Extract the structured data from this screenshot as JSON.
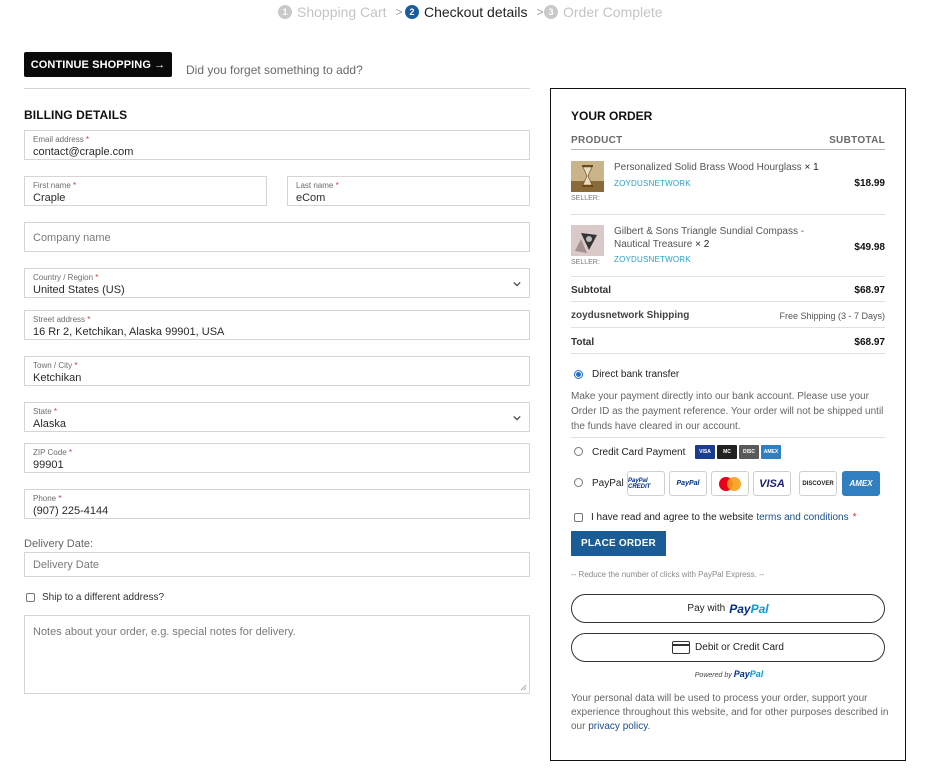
{
  "steps": [
    {
      "num": "1",
      "label": "Shopping Cart"
    },
    {
      "num": "2",
      "label": "Checkout details"
    },
    {
      "num": "3",
      "label": "Order Complete"
    }
  ],
  "continue_label": "CONTINUE SHOPPING →",
  "forgot_text": "Did you forget something to add?",
  "billing": {
    "title": "BILLING DETAILS",
    "email": {
      "label": "Email address",
      "value": "contact@craple.com"
    },
    "first_name": {
      "label": "First name",
      "value": "Craple"
    },
    "last_name": {
      "label": "Last name",
      "value": "eCom"
    },
    "company": {
      "placeholder": "Company name"
    },
    "country": {
      "label": "Country / Region",
      "value": "United States (US)"
    },
    "street": {
      "label": "Street address",
      "value": "16 Rr 2, Ketchikan, Alaska 99901, USA"
    },
    "city": {
      "label": "Town / City",
      "value": "Ketchikan"
    },
    "state": {
      "label": "State",
      "value": "Alaska"
    },
    "zip": {
      "label": "ZIP Code",
      "value": "99901"
    },
    "phone": {
      "label": "Phone",
      "value": "(907) 225-4144"
    },
    "delivery_label": "Delivery Date:",
    "delivery_placeholder": "Delivery Date",
    "ship_different": "Ship to a different address?",
    "notes_placeholder": "Notes about your order, e.g. special notes for delivery."
  },
  "order": {
    "title": "YOUR ORDER",
    "col_product": "PRODUCT",
    "col_subtotal": "SUBTOTAL",
    "items": [
      {
        "name": "Personalized Solid Brass Wood Hourglass",
        "qty": "× 1",
        "vendor": "ZOYDUSNETWORK",
        "seller": "SELLER:",
        "price": "$18.99"
      },
      {
        "name": "Gilbert & Sons Triangle Sundial Compass - Nautical Treasure",
        "qty": "× 2",
        "vendor": "ZOYDUSNETWORK",
        "seller": "SELLER:",
        "price": "$49.98"
      }
    ],
    "subtotal_label": "Subtotal",
    "subtotal_value": "$68.97",
    "shipping_label": "zoydusnetwork Shipping",
    "shipping_value": "Free Shipping (3 - 7 Days)",
    "total_label": "Total",
    "total_value": "$68.97",
    "payment": {
      "bank_label": "Direct bank transfer",
      "bank_desc": "Make your payment directly into our bank account. Please use your Order ID as the payment reference. Your order will not be shipped until the funds have cleared in our account.",
      "cc_label": "Credit Card Payment",
      "cc_cards": [
        "VISA",
        "MC",
        "DISC",
        "AMEX"
      ],
      "paypal_label": "PayPal",
      "paypal_cards": [
        "PayPal CREDIT",
        "PayPal",
        "",
        "VISA",
        "DISCOVER",
        "AMEX"
      ]
    },
    "terms_prefix": "I have read and agree to the website",
    "terms_link": "terms and conditions",
    "terms_req": "*",
    "place_order": "PLACE ORDER",
    "reduce_clicks": "-- Reduce the number of clicks with PayPal Express. --",
    "paypal_btn_prefix": "Pay with",
    "paypal_btn_pay": "Pay",
    "paypal_btn_pal": "Pal",
    "debit_btn": "Debit or Credit Card",
    "powered_by": "Powered by",
    "privacy_text": "Your personal data will be used to process your order, support your experience throughout this website, and for other purposes described in our",
    "privacy_link": "privacy policy",
    "privacy_end": "."
  },
  "colors": {
    "accent": "#1a5c95",
    "link": "#1a4f8a",
    "vendor": "#2aa0c9",
    "required": "#dd3333"
  }
}
